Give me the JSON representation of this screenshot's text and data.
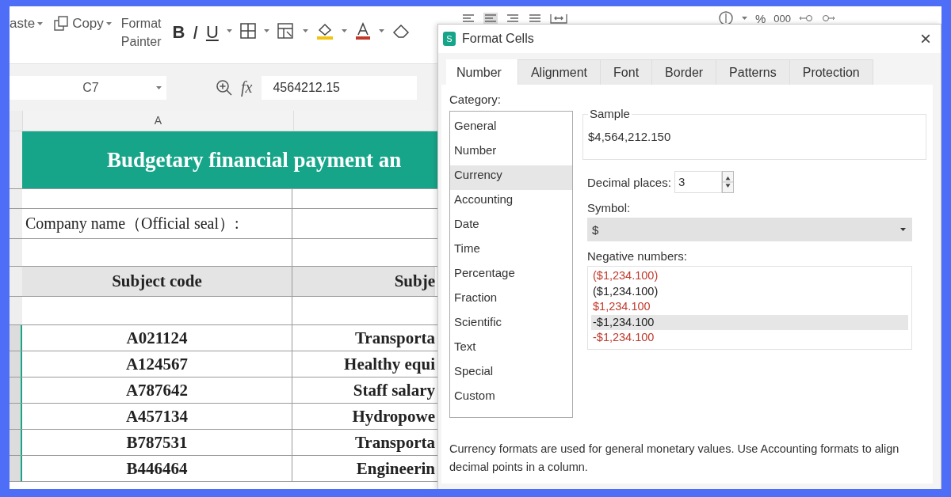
{
  "ribbon": {
    "clipboard": [
      {
        "label": "aste",
        "kind": "paste"
      },
      {
        "label": "Copy",
        "kind": "copy"
      }
    ],
    "format_painter": "Format\nPainter",
    "font_buttons": [
      "B",
      "I",
      "U"
    ],
    "number_format": {
      "percent": "%",
      "thousands": "000"
    }
  },
  "formula_bar": {
    "name_box": "C7",
    "fx": "fx",
    "value": "4564212.15"
  },
  "sheet": {
    "column_a": "A",
    "title": "Budgetary financial payment an",
    "company_label": "Company name（Official seal）:",
    "header": [
      "Subject code",
      "Subje"
    ],
    "rows": [
      [
        "A021124",
        "Transporta"
      ],
      [
        "A124567",
        "Healthy equi"
      ],
      [
        "A787642",
        "Staff salary"
      ],
      [
        "A457134",
        "Hydropowe"
      ],
      [
        "B787531",
        "Transporta"
      ],
      [
        "B446464",
        "Engineerin"
      ]
    ]
  },
  "dialog": {
    "icon_letter": "S",
    "title": "Format Cells",
    "close": "×",
    "tabs": [
      {
        "label": "Number",
        "selected": true
      },
      {
        "label": "Alignment",
        "selected": false
      },
      {
        "label": "Font",
        "selected": false
      },
      {
        "label": "Border",
        "selected": false
      },
      {
        "label": "Patterns",
        "selected": false
      },
      {
        "label": "Protection",
        "selected": false
      }
    ],
    "category_label": "Category:",
    "categories": [
      {
        "label": "General",
        "selected": false
      },
      {
        "label": "Number",
        "selected": false
      },
      {
        "label": "Currency",
        "selected": true
      },
      {
        "label": "Accounting",
        "selected": false
      },
      {
        "label": "Date",
        "selected": false
      },
      {
        "label": "Time",
        "selected": false
      },
      {
        "label": "Percentage",
        "selected": false
      },
      {
        "label": "Fraction",
        "selected": false
      },
      {
        "label": "Scientific",
        "selected": false
      },
      {
        "label": "Text",
        "selected": false
      },
      {
        "label": "Special",
        "selected": false
      },
      {
        "label": "Custom",
        "selected": false
      }
    ],
    "sample_label": "Sample",
    "sample_value": "$4,564,212.150",
    "decimal_label": "Decimal places:",
    "decimal_value": "3",
    "symbol_label": "Symbol:",
    "symbol_value": "$",
    "negative_label": "Negative numbers:",
    "negative_numbers": [
      {
        "label": "($1,234.100)",
        "color": "#c0392b",
        "selected": false
      },
      {
        "label": "($1,234.100)",
        "color": "#222222",
        "selected": false
      },
      {
        "label": "$1,234.100",
        "color": "#c0392b",
        "selected": false
      },
      {
        "label": "-$1,234.100",
        "color": "#222222",
        "selected": true
      },
      {
        "label": "-$1,234.100",
        "color": "#c0392b",
        "selected": false
      }
    ],
    "description": "Currency formats are used for general monetary values. Use Accounting formats to align decimal points in a column."
  }
}
